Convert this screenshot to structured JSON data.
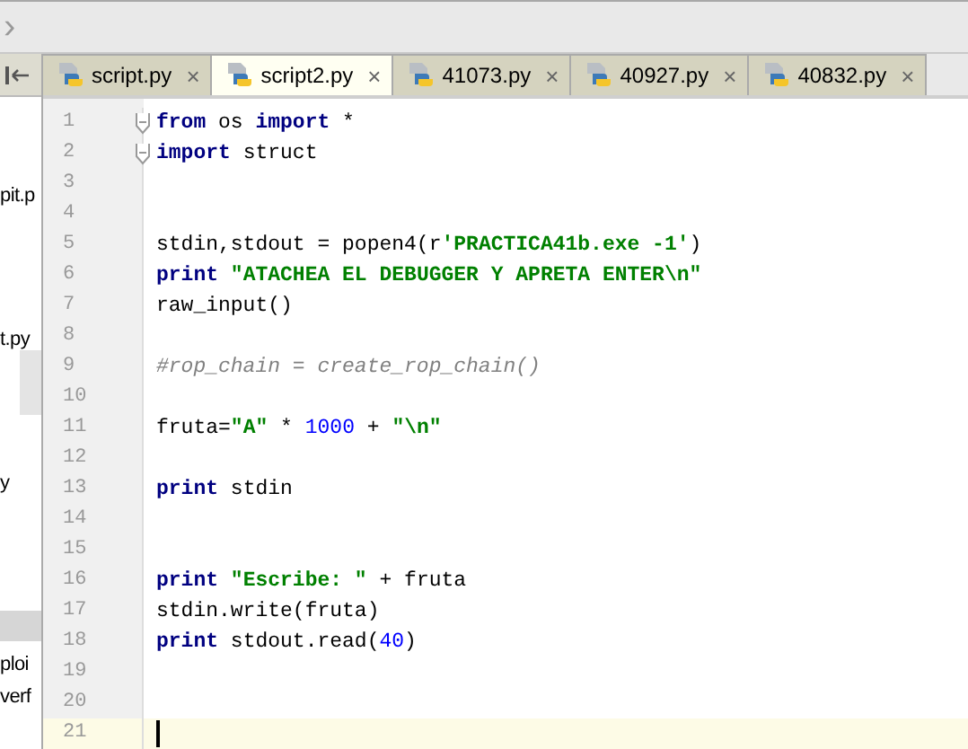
{
  "navigation_bar": {
    "separator": "›"
  },
  "project_panel": {
    "items": [
      {
        "label": "pit.p",
        "selected": false
      },
      {
        "label": "t.py",
        "selected": false
      },
      {
        "label": "y",
        "selected": false
      },
      {
        "label": "ploi",
        "selected": false
      },
      {
        "label": "verf",
        "selected": false
      }
    ]
  },
  "tabs": [
    {
      "label": "script.py",
      "selected": false,
      "close": "×"
    },
    {
      "label": "script2.py",
      "selected": true,
      "close": "×"
    },
    {
      "label": "41073.py",
      "selected": false,
      "close": "×"
    },
    {
      "label": "40927.py",
      "selected": false,
      "close": "×"
    },
    {
      "label": "40832.py",
      "selected": false,
      "close": "×"
    }
  ],
  "editor": {
    "lines": [
      {
        "number": "1",
        "fold": true,
        "current": false,
        "segments": [
          {
            "kind": "keyword",
            "text": "from"
          },
          {
            "kind": "plain",
            "text": " os "
          },
          {
            "kind": "keyword",
            "text": "import"
          },
          {
            "kind": "plain",
            "text": " *"
          }
        ]
      },
      {
        "number": "2",
        "fold": true,
        "current": false,
        "segments": [
          {
            "kind": "keyword",
            "text": "import"
          },
          {
            "kind": "plain",
            "text": " struct"
          }
        ]
      },
      {
        "number": "3",
        "fold": false,
        "current": false
      },
      {
        "number": "4",
        "fold": false,
        "current": false
      },
      {
        "number": "5",
        "fold": false,
        "current": false,
        "segments": [
          {
            "kind": "plain",
            "text": "stdin,stdout = popen4(r"
          },
          {
            "kind": "string",
            "text": "'PRACTICA41b.exe -1'"
          },
          {
            "kind": "plain",
            "text": ")"
          }
        ]
      },
      {
        "number": "6",
        "fold": false,
        "current": false,
        "segments": [
          {
            "kind": "keyword",
            "text": "print "
          },
          {
            "kind": "string",
            "text": "\"ATACHEA EL DEBUGGER Y APRETA ENTER\\n\""
          }
        ]
      },
      {
        "number": "7",
        "fold": false,
        "current": false,
        "segments": [
          {
            "kind": "plain",
            "text": "raw_input()"
          }
        ]
      },
      {
        "number": "8",
        "fold": false,
        "current": false
      },
      {
        "number": "9",
        "fold": false,
        "current": false,
        "segments": [
          {
            "kind": "comment",
            "text": "#rop_chain = create_rop_chain()"
          }
        ]
      },
      {
        "number": "10",
        "fold": false,
        "current": false
      },
      {
        "number": "11",
        "fold": false,
        "current": false,
        "segments": [
          {
            "kind": "plain",
            "text": "fruta="
          },
          {
            "kind": "string",
            "text": "\"A\""
          },
          {
            "kind": "plain",
            "text": " * "
          },
          {
            "kind": "number",
            "text": "1000"
          },
          {
            "kind": "plain",
            "text": " + "
          },
          {
            "kind": "string",
            "text": "\"\\n\""
          }
        ]
      },
      {
        "number": "12",
        "fold": false,
        "current": false
      },
      {
        "number": "13",
        "fold": false,
        "current": false,
        "segments": [
          {
            "kind": "keyword",
            "text": "print"
          },
          {
            "kind": "plain",
            "text": " stdin"
          }
        ]
      },
      {
        "number": "14",
        "fold": false,
        "current": false
      },
      {
        "number": "15",
        "fold": false,
        "current": false
      },
      {
        "number": "16",
        "fold": false,
        "current": false,
        "segments": [
          {
            "kind": "keyword",
            "text": "print "
          },
          {
            "kind": "string",
            "text": "\"Escribe: \""
          },
          {
            "kind": "plain",
            "text": " + fruta"
          }
        ]
      },
      {
        "number": "17",
        "fold": false,
        "current": false,
        "segments": [
          {
            "kind": "plain",
            "text": "stdin.write(fruta)"
          }
        ]
      },
      {
        "number": "18",
        "fold": false,
        "current": false,
        "segments": [
          {
            "kind": "keyword",
            "text": "print"
          },
          {
            "kind": "plain",
            "text": " stdout.read("
          },
          {
            "kind": "number",
            "text": "40"
          },
          {
            "kind": "plain",
            "text": ")"
          }
        ]
      },
      {
        "number": "19",
        "fold": false,
        "current": false
      },
      {
        "number": "20",
        "fold": false,
        "current": false
      },
      {
        "number": "21",
        "fold": false,
        "current": true
      }
    ]
  }
}
